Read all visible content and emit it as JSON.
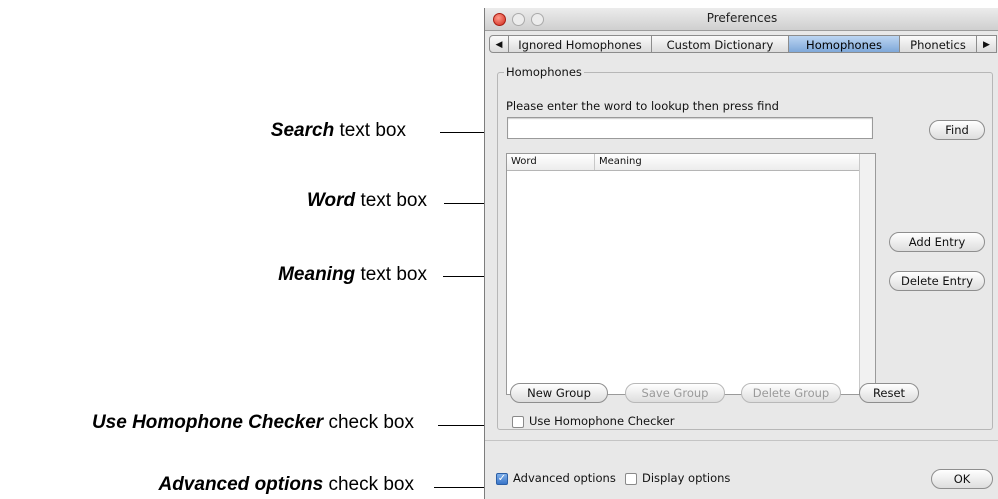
{
  "window": {
    "title": "Preferences"
  },
  "tabs": {
    "left_arrow": "◀",
    "right_arrow": "▶",
    "items": [
      {
        "label": "Ignored Homophones"
      },
      {
        "label": "Custom Dictionary"
      },
      {
        "label": "Homophones",
        "active": true
      },
      {
        "label": "Phonetics"
      }
    ]
  },
  "homophones": {
    "group_label": "Homophones",
    "prompt": "Please enter the word to lookup then press find",
    "search_value": "",
    "find_label": "Find",
    "table": {
      "columns": [
        "Word",
        "Meaning"
      ],
      "rows": []
    },
    "add_entry_label": "Add Entry",
    "delete_entry_label": "Delete Entry",
    "new_group_label": "New Group",
    "save_group_label": "Save Group",
    "delete_group_label": "Delete Group",
    "reset_label": "Reset",
    "use_checker_label": "Use Homophone Checker",
    "use_checker_checked": false
  },
  "footer": {
    "advanced_label": "Advanced options",
    "advanced_checked": true,
    "display_label": "Display options",
    "display_checked": false,
    "ok_label": "OK"
  },
  "callouts": [
    {
      "bold": "Search",
      "rest": " text box"
    },
    {
      "bold": "Word",
      "rest": " text box"
    },
    {
      "bold": "Meaning",
      "rest": " text box"
    },
    {
      "bold": "Use Homophone Checker",
      "rest": " check box"
    },
    {
      "bold": "Advanced options",
      "rest": " check box"
    }
  ]
}
